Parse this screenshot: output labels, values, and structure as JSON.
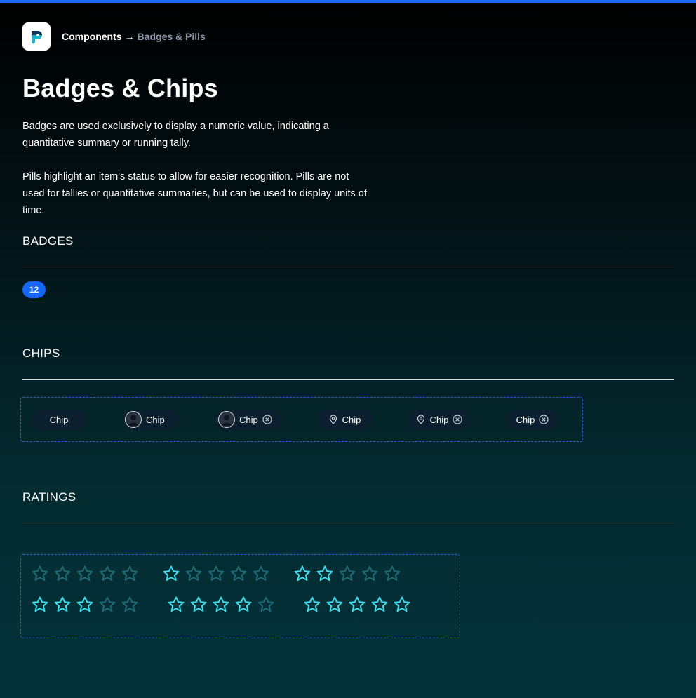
{
  "header": {
    "breadcrumb_parent": "Components",
    "breadcrumb_arrow": "→",
    "breadcrumb_current": "Badges & Pills"
  },
  "page": {
    "title": "Badges & Chips",
    "description_badges": "Badges are used exclusively to display a numeric value, indicating a quantitative summary or running tally.",
    "description_pills": "Pills highlight an item's status to allow for easier recognition. Pills are not used for tallies or quantitative summaries, but can be used to display units of time."
  },
  "badges": {
    "title": "BADGES",
    "items": [
      {
        "value": "12",
        "color": "#1467f5"
      }
    ]
  },
  "chips": {
    "title": "CHIPS",
    "items": [
      {
        "label": "Chip",
        "leading": "none",
        "trailing": "none"
      },
      {
        "label": "Chip",
        "leading": "avatar",
        "trailing": "none"
      },
      {
        "label": "Chip",
        "leading": "avatar",
        "trailing": "close-icon"
      },
      {
        "label": "Chip",
        "leading": "location-pin-icon",
        "trailing": "none"
      },
      {
        "label": "Chip",
        "leading": "location-pin-icon",
        "trailing": "close-icon"
      },
      {
        "label": "Chip",
        "leading": "none",
        "trailing": "close-icon"
      }
    ]
  },
  "ratings": {
    "title": "RATINGS",
    "max": 5,
    "values": [
      0,
      1,
      2,
      3,
      4,
      5
    ],
    "active_color": "#3fe0f0",
    "inactive_color": "#1f6a78"
  }
}
